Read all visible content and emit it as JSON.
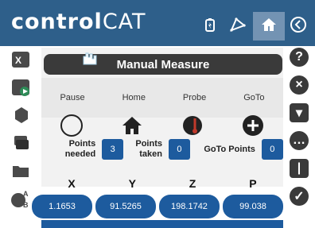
{
  "app": {
    "logo_bold": "control",
    "logo_light": "CAT"
  },
  "topbar": {
    "icons": [
      "battery-icon",
      "network-icon",
      "home-icon",
      "back-icon"
    ]
  },
  "panel": {
    "title": "Manual Measure",
    "menu": [
      "Pause",
      "Home",
      "Probe",
      "GoTo"
    ],
    "counts": {
      "points_needed_label": "Points\nneeded",
      "points_needed_value": "3",
      "points_taken_label": "Points\ntaken",
      "points_taken_value": "0",
      "goto_points_label": "GoTo Points",
      "goto_points_value": "0"
    }
  },
  "coords": {
    "labels": [
      "X",
      "Y",
      "Z",
      "P"
    ],
    "values": [
      "1.1653",
      "91.5265",
      "198.1742",
      "99.038"
    ]
  }
}
